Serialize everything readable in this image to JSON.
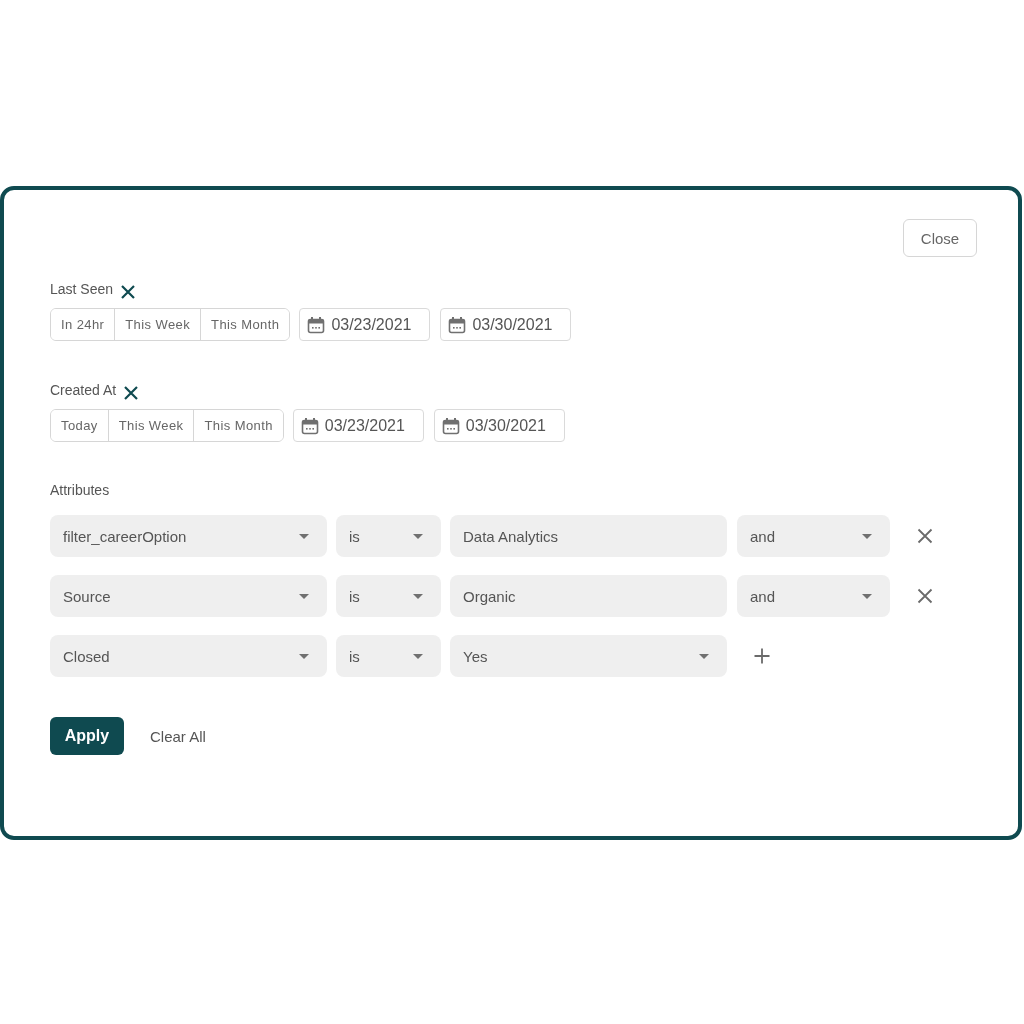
{
  "close_button": {
    "label": "Close"
  },
  "date_filters": [
    {
      "label": "Last Seen",
      "presets": [
        {
          "label": "In 24hr",
          "selected": false
        },
        {
          "label": "This Week",
          "selected": false
        },
        {
          "label": "This Month",
          "selected": false
        }
      ],
      "start_date": "03/23/2021",
      "end_date": "03/30/2021"
    },
    {
      "label": "Created At",
      "presets": [
        {
          "label": "Today",
          "selected": false
        },
        {
          "label": "This Week",
          "selected": false
        },
        {
          "label": "This Month",
          "selected": false
        }
      ],
      "start_date": "03/23/2021",
      "end_date": "03/30/2021"
    }
  ],
  "attributes": {
    "label": "Attributes",
    "rows": [
      {
        "kind": "condition",
        "field": "filter_careerOption",
        "operator": "is",
        "value": "Data Analytics",
        "conjunction": "and"
      },
      {
        "kind": "condition",
        "field": "Source",
        "operator": "is",
        "value": "Organic",
        "conjunction": "and"
      },
      {
        "kind": "new",
        "field": "Closed",
        "operator": "is",
        "value": "Yes"
      }
    ]
  },
  "actions": {
    "apply": "Apply",
    "clear": "Clear All"
  }
}
